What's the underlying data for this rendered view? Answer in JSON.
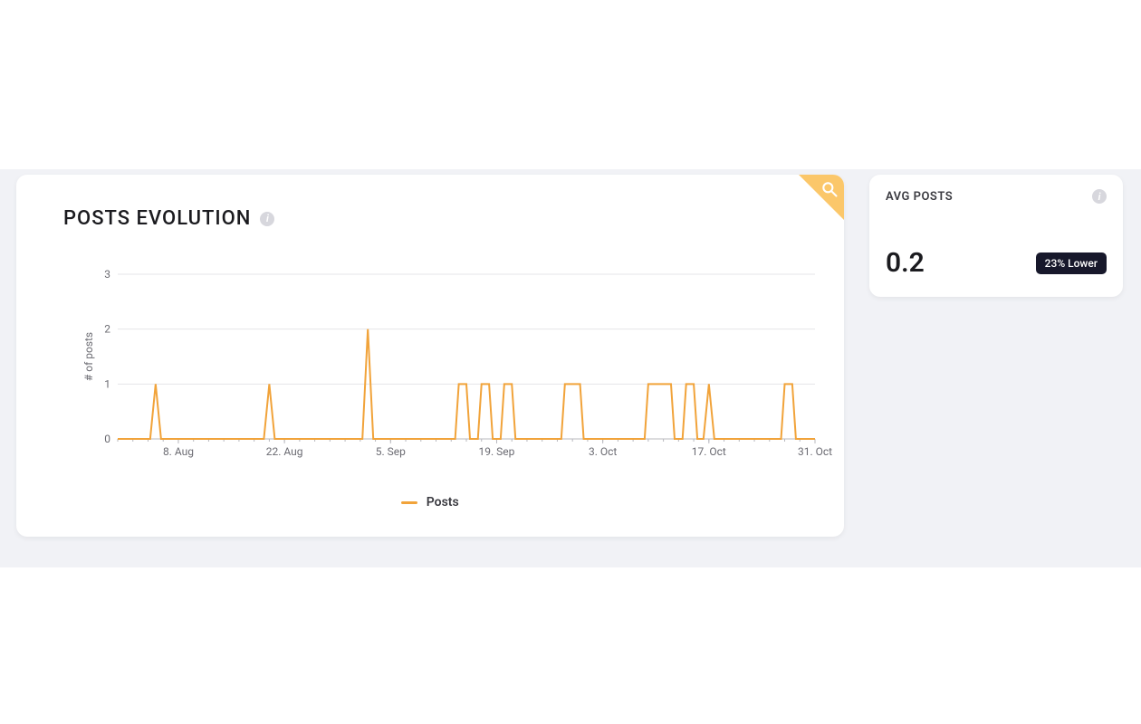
{
  "main_card": {
    "title": "POSTS EVOLUTION",
    "corner_icon": "search-icon",
    "legend_label": "Posts"
  },
  "side_card": {
    "title": "AVG POSTS",
    "value": "0.2",
    "badge": "23% Lower"
  },
  "chart_data": {
    "type": "line",
    "ylabel": "# of posts",
    "ylim": [
      0,
      3
    ],
    "y_ticks": [
      0,
      1,
      2,
      3
    ],
    "x_range_days": 92,
    "x_ticks": [
      {
        "day": 8,
        "label": "8. Aug"
      },
      {
        "day": 22,
        "label": "22. Aug"
      },
      {
        "day": 36,
        "label": "5. Sep"
      },
      {
        "day": 50,
        "label": "19. Sep"
      },
      {
        "day": 64,
        "label": "3. Oct"
      },
      {
        "day": 78,
        "label": "17. Oct"
      },
      {
        "day": 92,
        "label": "31. Oct"
      }
    ],
    "series": [
      {
        "name": "Posts",
        "color": "#f1a33a",
        "plateaus": [
          {
            "start": 5,
            "end": 5,
            "value": 1
          },
          {
            "start": 20,
            "end": 20,
            "value": 1
          },
          {
            "start": 33,
            "end": 33,
            "value": 2
          },
          {
            "start": 45,
            "end": 46,
            "value": 1
          },
          {
            "start": 48,
            "end": 49,
            "value": 1
          },
          {
            "start": 51,
            "end": 52,
            "value": 1
          },
          {
            "start": 59,
            "end": 61,
            "value": 1
          },
          {
            "start": 70,
            "end": 73,
            "value": 1
          },
          {
            "start": 75,
            "end": 76,
            "value": 1
          },
          {
            "start": 78,
            "end": 78,
            "value": 1
          },
          {
            "start": 88,
            "end": 89,
            "value": 1
          }
        ]
      }
    ]
  }
}
